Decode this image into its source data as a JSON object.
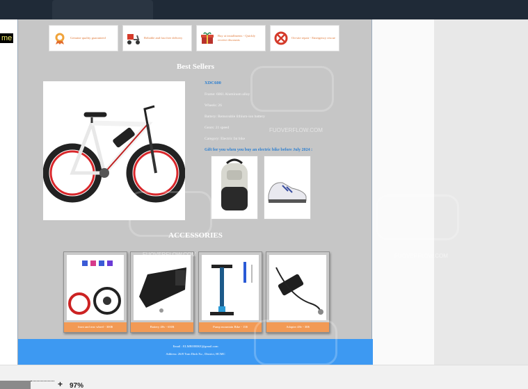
{
  "top_label": "me",
  "webpage": {
    "features": [
      {
        "text": "Genuine quality guaranteed",
        "icon": "medal-icon"
      },
      {
        "text": "Reliable and fast free delivery",
        "icon": "delivery-scooter-icon"
      },
      {
        "text": "Buy at installments - Quickly receive discounts",
        "icon": "gift-icon"
      },
      {
        "text": "On-site repair - Emergency rescue",
        "icon": "repair-tools-icon"
      }
    ],
    "best_sellers_title": "Best Sellers",
    "product": {
      "name": "XDC600",
      "specs": [
        "Frame: 6061 Aluminum alloy",
        "Wheels: 26",
        "Battery: Removable lithium-ion battery",
        "Gears: 21 speed",
        "Category: Electric fat bike"
      ],
      "gift_text": "Gift for you when you buy an electric bike before July 2024 :",
      "gift_items": [
        "backpack",
        "sneaker"
      ]
    },
    "accessories_title": "ACCESSORIES",
    "accessories": [
      {
        "caption": "front and rear wheel - 300$",
        "image": "wheel-kit"
      },
      {
        "caption": "Battery 48v - 650$",
        "image": "battery"
      },
      {
        "caption": "Pump mountain Bike - 15$",
        "image": "pump"
      },
      {
        "caption": "Adapter 48v - 30$",
        "image": "adapter"
      }
    ],
    "footer": {
      "email": "Email : ELMBOBIKE@gmail.com",
      "address": "Address: 26/8 Tran Dinh Xu , District, HCMC"
    }
  },
  "watermark": "FUOVERFLOW.COM",
  "zoom_plus": "+",
  "zoom_level": "97%",
  "colors": {
    "accent": "#2d7fd0",
    "footer": "#3d99f2",
    "caption": "#f29a55",
    "page_bg": "#c6c6c6"
  }
}
